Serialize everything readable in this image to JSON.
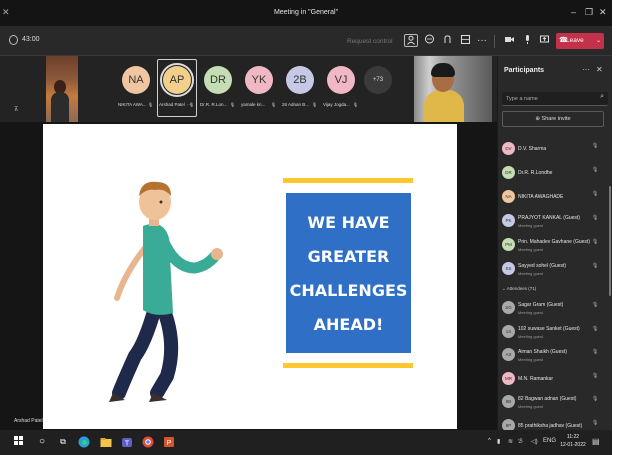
{
  "window": {
    "title": "Meeting in \"General\"",
    "minimize": "–",
    "maximize": "❐",
    "close": "✕",
    "left_close": "✕"
  },
  "controls": {
    "timer": "43:00",
    "request_control": "Request control",
    "leave_label": "Leave"
  },
  "strip": {
    "participants": [
      {
        "initials": "NA",
        "label": "NIKITA AWA...",
        "color": "#f0c6a0"
      },
      {
        "initials": "AP",
        "label": "Arshad Patel",
        "color": "#f2d089",
        "active": true
      },
      {
        "initials": "DR",
        "label": "Dr.R. R.Lon...",
        "color": "#c5ddb2"
      },
      {
        "initials": "YK",
        "label": "yamale kri...",
        "color": "#f0b8c2"
      },
      {
        "initials": "2B",
        "label": "26 Adnan B...",
        "color": "#c5c9e6"
      },
      {
        "initials": "VJ",
        "label": "Vijay Jogda...",
        "color": "#f0b8c2"
      }
    ],
    "overflow": "+73",
    "more_dots": "···"
  },
  "stage": {
    "presenter_label": "Arshad Patel",
    "slide_lines": [
      "WE HAVE",
      "GREATER",
      "CHALLENGES",
      "AHEAD!"
    ]
  },
  "participants_panel": {
    "title": "Participants",
    "search_placeholder": "Type a name",
    "share_invite": "Share invite",
    "presenters": [
      {
        "name": "D.V. Sharma",
        "sub": "",
        "color": "#f0b8c2",
        "initials": "DV"
      },
      {
        "name": "Dr.R. R.Londhe",
        "sub": "",
        "color": "#c5ddb2",
        "initials": "DR"
      },
      {
        "name": "NIKITA AWAGHADE",
        "sub": "",
        "color": "#f0c6a0",
        "initials": "NA"
      },
      {
        "name": "PRAJYOT KANKAL (Guest)",
        "sub": "Meeting guest",
        "color": "#c5c9e6",
        "initials": "PK"
      },
      {
        "name": "Prin. Mahadev Gavhane (Guest)",
        "sub": "Meeting guest",
        "color": "#c5ddb2",
        "initials": "PM"
      },
      {
        "name": "Sayyed sohel (Guest)",
        "sub": "Meeting guest",
        "color": "#c5c9e6",
        "initials": "SS"
      }
    ],
    "attendees_label": "Attendees (71)",
    "attendees": [
      {
        "name": "Sagar Gram (Guest)",
        "sub": "Meeting guest",
        "color": "#a8a8a8",
        "initials": "SG"
      },
      {
        "name": "102 suwase Sanket (Guest)",
        "sub": "Meeting guest",
        "color": "#a8a8a8",
        "initials": "1S"
      },
      {
        "name": "Aiman Shaikh (Guest)",
        "sub": "Meeting guest",
        "color": "#a8a8a8",
        "initials": "AS"
      },
      {
        "name": "M.N. Ramankar",
        "sub": "",
        "color": "#f0b8c2",
        "initials": "MR"
      },
      {
        "name": "82 Bagwan adnan (Guest)",
        "sub": "Meeting guest",
        "color": "#a8a8a8",
        "initials": "8B"
      },
      {
        "name": "85 prathiksha jadhav (Guest)",
        "sub": "",
        "color": "#a8a8a8",
        "initials": "8P"
      }
    ]
  },
  "taskbar": {
    "lang": "ENG",
    "time": "11:22",
    "date": "12-01-2022"
  }
}
